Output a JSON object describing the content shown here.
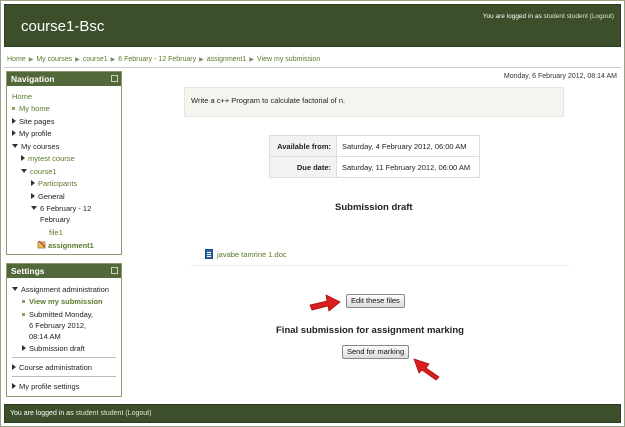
{
  "header": {
    "site_title": "course1-Bsc",
    "login_prefix": "You are logged in as",
    "login_user": "student student",
    "logout": "(Logout)"
  },
  "breadcrumb": [
    "Home",
    "My courses",
    "course1",
    "6 February - 12 February",
    "assignment1",
    "View my submission"
  ],
  "navigation": {
    "title": "Navigation",
    "home": "Home",
    "my_home": "My home",
    "site_pages": "Site pages",
    "my_profile": "My profile",
    "my_courses": "My courses",
    "mytest_course": "mytest course",
    "course1": "course1",
    "participants": "Participants",
    "general": "General",
    "week_line1": "6 February - 12",
    "week_line2": "February",
    "file1": "file1",
    "assignment1": "assignment1"
  },
  "settings": {
    "title": "Settings",
    "assignment_admin": "Assignment administration",
    "view_submission": "View my submission",
    "submitted_line1": "Submitted Monday,",
    "submitted_line2": "6 February 2012,",
    "submitted_line3": "08:14 AM",
    "submission_draft": "Submission draft",
    "course_admin": "Course administration",
    "profile_settings": "My profile settings"
  },
  "main": {
    "current_date": "Monday, 6 February 2012, 08:14 AM",
    "intro": "Write a c++ Program to calculate factorial of n.",
    "dates": [
      {
        "label": "Available from:",
        "value": "Saturday, 4 February 2012, 06:00 AM"
      },
      {
        "label": "Due date:",
        "value": "Saturday, 11 February 2012, 06:00 AM"
      }
    ],
    "draft_heading": "Submission draft",
    "file_name": "javabe tamrine 1.doc",
    "edit_button": "Edit these files",
    "final_heading": "Final submission for assignment marking",
    "send_button": "Send for marking"
  },
  "footer": {
    "prefix": "You are logged in as",
    "user": "student student",
    "logout": "(Logout)"
  },
  "colors": {
    "header_bg": "#3c4f2a",
    "block_head": "#52683a",
    "link_green": "#5a7a2c",
    "arrow_red": "#d91e1e"
  }
}
